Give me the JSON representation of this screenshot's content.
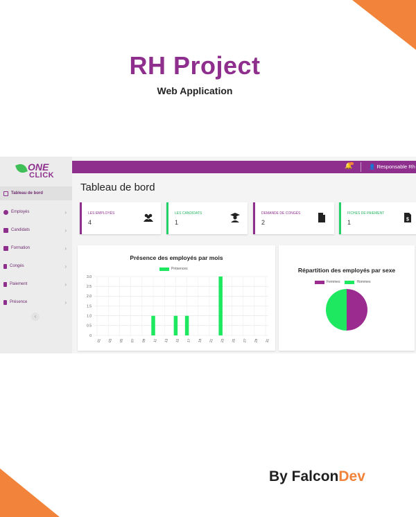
{
  "poster": {
    "title": "RH Project",
    "subtitle": "Web Application",
    "byline_prefix": "By Falcon",
    "byline_accent": "Dev",
    "accent_color": "#f2833a",
    "brand_color": "#8e2f8e"
  },
  "app": {
    "logo": {
      "line1": "ONE",
      "line2": "CLICK"
    },
    "sidebar": {
      "items": [
        {
          "label": "Tableau de bord",
          "icon": "dashboard-icon",
          "active": true
        },
        {
          "label": "Employés",
          "icon": "users-icon"
        },
        {
          "label": "Candidats",
          "icon": "hourglass-icon"
        },
        {
          "label": "Formation",
          "icon": "training-icon"
        },
        {
          "label": "Congés",
          "icon": "document-icon"
        },
        {
          "label": "Paiement",
          "icon": "payslip-icon"
        },
        {
          "label": "Présence",
          "icon": "badge-icon"
        }
      ],
      "collapse_glyph": "‹"
    },
    "topbar": {
      "user_label": "Responsable Rh",
      "icons": [
        "bell-icon",
        "user-icon"
      ]
    },
    "page_title": "Tableau de bord",
    "cards": [
      {
        "label": "LES EMPLOYÉS",
        "value": "4",
        "icon": "users-icon",
        "color": "#8e2f8e"
      },
      {
        "label": "LES CANDIDATS",
        "value": "1",
        "icon": "graduate-icon",
        "color": "#23d16a"
      },
      {
        "label": "DEMANDE DE CONGÉS",
        "value": "2",
        "icon": "file-icon",
        "color": "#8e2f8e"
      },
      {
        "label": "FICHES DE PAIEMENT",
        "value": "1",
        "icon": "invoice-dollar-icon",
        "color": "#23d16a"
      }
    ]
  },
  "chart_data": [
    {
      "type": "bar",
      "title": "Présence des employés par mois",
      "series": [
        {
          "name": "Présences",
          "color": "#1ee85f",
          "values": [
            0,
            0,
            0,
            0,
            0,
            0,
            0,
            0,
            0,
            0,
            1,
            0,
            0,
            0,
            1,
            0,
            1,
            0,
            0,
            0,
            0,
            0,
            3,
            0,
            0,
            0,
            0,
            0,
            0,
            0,
            0
          ]
        }
      ],
      "x": [
        "01",
        "02",
        "03",
        "04",
        "05",
        "06",
        "07",
        "08",
        "09",
        "10",
        "11",
        "12",
        "13",
        "14",
        "15",
        "16",
        "17",
        "18",
        "19",
        "20",
        "21",
        "22",
        "23",
        "24",
        "25",
        "26",
        "27",
        "28",
        "29",
        "30",
        "31"
      ],
      "x_tick_labels": [
        "01",
        "03",
        "05",
        "07",
        "09",
        "11",
        "13",
        "15",
        "17",
        "19",
        "21",
        "23",
        "25",
        "27",
        "29",
        "31"
      ],
      "ylim": [
        0,
        3
      ],
      "y_ticks": [
        "0",
        "0.5",
        "1.0",
        "1.5",
        "2.0",
        "2.5",
        "3.0"
      ],
      "grid": true,
      "legend": "top-center"
    },
    {
      "type": "pie",
      "title": "Répartition des employés par sexe",
      "categories": [
        "Femmes",
        "Hommes"
      ],
      "values": [
        2,
        2
      ],
      "colors": [
        "#9b2b8f",
        "#1ee85f"
      ],
      "legend": "top-center"
    }
  ]
}
